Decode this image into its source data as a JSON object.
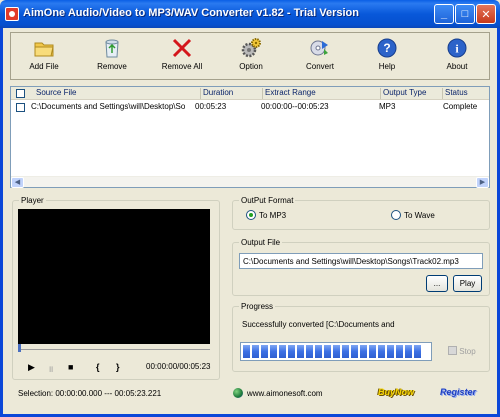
{
  "window": {
    "title": "AimOne Audio/Video to MP3/WAV Converter v1.82 - Trial Version",
    "minimize_glyph": "_",
    "maximize_glyph": "□",
    "close_glyph": "✕"
  },
  "toolbar": {
    "add_file": "Add File",
    "remove": "Remove",
    "remove_all": "Remove All",
    "option": "Option",
    "convert": "Convert",
    "help": "Help",
    "about": "About"
  },
  "file_list": {
    "columns": [
      "Source File",
      "Duration",
      "Extract Range",
      "Output Type",
      "Status"
    ],
    "rows": [
      {
        "source": "C:\\Documents and Settings\\will\\Desktop\\So",
        "duration": "00:05:23",
        "range": "00:00:00--00:05:23",
        "output_type": "MP3",
        "status": "Complete"
      }
    ]
  },
  "player": {
    "title": "Player",
    "play_glyph": "▶",
    "pause_glyph": "॥",
    "stop_glyph": "■",
    "mark_in_glyph": "{",
    "mark_out_glyph": "}",
    "time": "00:00:00/00:05:23",
    "seek_fraction": 0,
    "selection": "Selection: 00:00:00.000 --- 00:05:23.221"
  },
  "output_format": {
    "title": "OutPut Format",
    "to_mp3": "To MP3",
    "to_wave": "To Wave",
    "selected": "To MP3"
  },
  "output_file": {
    "title": "Output File",
    "path": "C:\\Documents and Settings\\will\\Desktop\\Songs\\Track02.mp3",
    "browse_label": "...",
    "play_label": "Play"
  },
  "progress": {
    "title": "Progress",
    "message": "Successfully converted [C:\\Documents and",
    "percent": 100,
    "stop_label": "Stop"
  },
  "footer": {
    "website": "www.aimonesoft.com",
    "buy_now": "BuyNow",
    "register": "Register"
  },
  "colors": {
    "titlebar": "#0858DA",
    "progress_fill": "#3C70E4",
    "buy_now": "#F5D300",
    "register": "#1E3FC2"
  }
}
